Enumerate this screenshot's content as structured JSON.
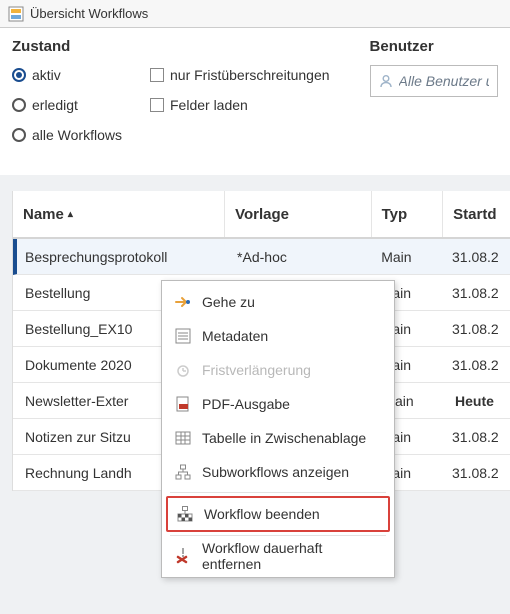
{
  "window": {
    "title": "Übersicht Workflows"
  },
  "filters": {
    "zustand": {
      "heading": "Zustand",
      "radios": [
        {
          "key": "aktiv",
          "label": "aktiv",
          "checked": true
        },
        {
          "key": "erledigt",
          "label": "erledigt",
          "checked": false
        },
        {
          "key": "alle",
          "label": "alle Workflows",
          "checked": false
        }
      ],
      "checks": [
        {
          "key": "frist",
          "label": "nur Fristüberschreitungen"
        },
        {
          "key": "felder",
          "label": "Felder laden"
        }
      ]
    },
    "benutzer": {
      "heading": "Benutzer",
      "placeholder": "Alle Benutzer und Gr"
    }
  },
  "grid": {
    "columns": {
      "name": "Name",
      "vorlage": "Vorlage",
      "typ": "Typ",
      "start": "Startd"
    },
    "rows": [
      {
        "name": "Besprechungsprotokoll",
        "vorlage": "*Ad-hoc",
        "typ": "Main",
        "start": "31.08.2",
        "selected": true
      },
      {
        "name": "Bestellung",
        "vorlage": "",
        "typ": "Main",
        "start": "31.08.2"
      },
      {
        "name": "Bestellung_EX10",
        "vorlage": "",
        "typ": "Main",
        "start": "31.08.2"
      },
      {
        "name": "Dokumente 2020",
        "vorlage": "",
        "typ": "Main",
        "start": "31.08.2"
      },
      {
        "name": "Newsletter-Exter",
        "vorlage": "",
        "typ": "Main",
        "start": "Heute",
        "bold_start": true
      },
      {
        "name": "Notizen zur Sitzu",
        "vorlage": "",
        "typ": "Main",
        "start": "31.08.2"
      },
      {
        "name": "Rechnung Landh",
        "vorlage": "",
        "typ": "Main",
        "start": "31.08.2"
      }
    ]
  },
  "context_menu": {
    "items": [
      {
        "key": "goto",
        "label": "Gehe zu"
      },
      {
        "key": "meta",
        "label": "Metadaten"
      },
      {
        "key": "frist",
        "label": "Fristverlängerung",
        "disabled": true
      },
      {
        "key": "pdf",
        "label": "PDF-Ausgabe"
      },
      {
        "key": "table",
        "label": "Tabelle in Zwischenablage"
      },
      {
        "key": "sub",
        "label": "Subworkflows anzeigen"
      },
      {
        "key": "end",
        "label": "Workflow beenden",
        "highlighted": true
      },
      {
        "key": "del",
        "label": "Workflow dauerhaft entfernen"
      }
    ]
  }
}
